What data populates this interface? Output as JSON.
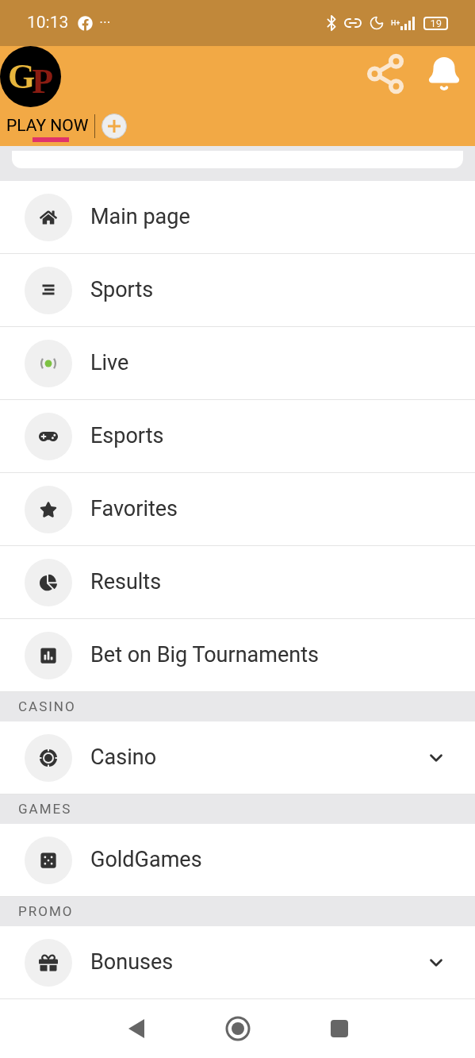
{
  "status_bar": {
    "time": "10:13",
    "more": "···",
    "network": "H+",
    "battery": "19"
  },
  "header": {
    "logo": {
      "first": "G",
      "second": "P"
    },
    "tabs": [
      {
        "label": "PLAY NOW",
        "selected": true
      }
    ]
  },
  "menu": [
    {
      "kind": "item",
      "label": "Main page",
      "expandable": false
    },
    {
      "kind": "item",
      "label": "Sports",
      "expandable": false
    },
    {
      "kind": "item",
      "label": "Live",
      "expandable": false
    },
    {
      "kind": "item",
      "label": "Esports",
      "expandable": false
    },
    {
      "kind": "item",
      "label": "Favorites",
      "expandable": false
    },
    {
      "kind": "item",
      "label": "Results",
      "expandable": false
    },
    {
      "kind": "item",
      "label": "Bet on Big Tournaments",
      "expandable": false
    },
    {
      "kind": "header",
      "label": "CASINO"
    },
    {
      "kind": "item",
      "label": "Casino",
      "expandable": true
    },
    {
      "kind": "header",
      "label": "GAMES"
    },
    {
      "kind": "item",
      "label": "GoldGames",
      "expandable": false
    },
    {
      "kind": "header",
      "label": "PROMO"
    },
    {
      "kind": "item",
      "label": "Bonuses",
      "expandable": true
    }
  ]
}
